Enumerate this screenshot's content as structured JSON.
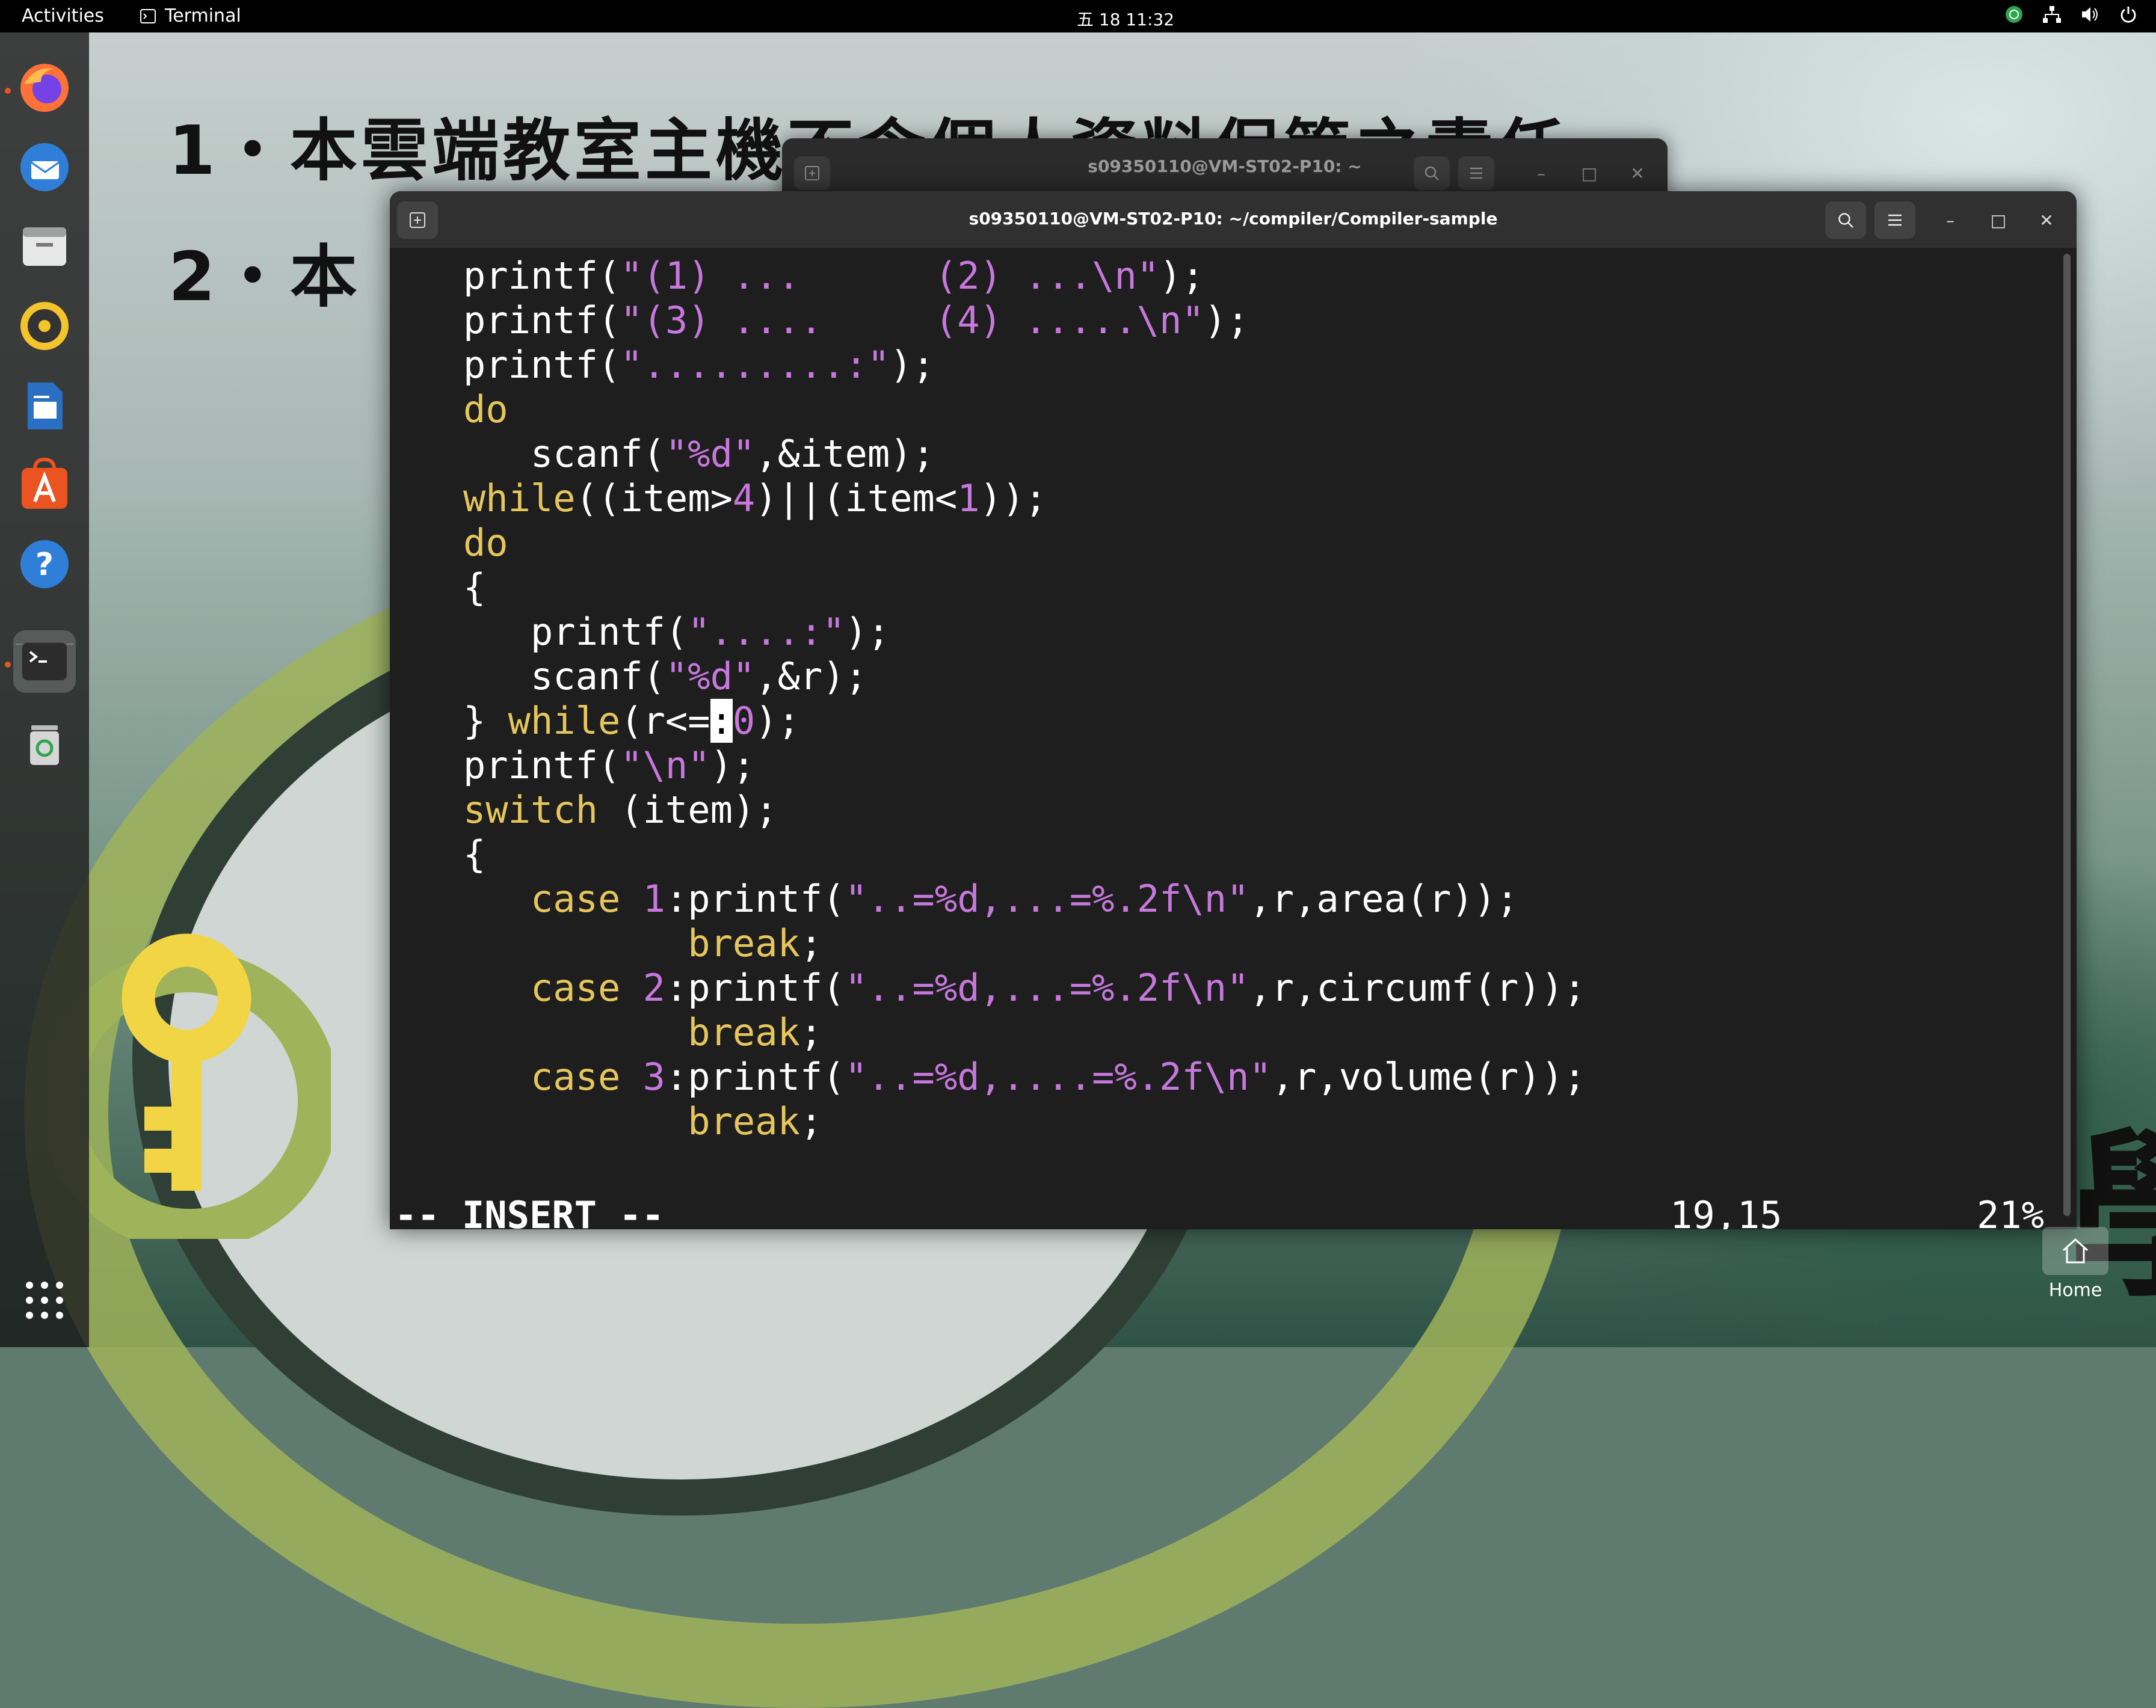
{
  "topbar": {
    "activities": "Activities",
    "app_name": "Terminal",
    "clock": "五 18 11:32"
  },
  "dock": {
    "items": [
      {
        "name": "firefox-icon"
      },
      {
        "name": "thunderbird-icon"
      },
      {
        "name": "files-icon"
      },
      {
        "name": "rhythmbox-icon"
      },
      {
        "name": "libreoffice-writer-icon"
      },
      {
        "name": "app-center-icon"
      },
      {
        "name": "help-icon"
      },
      {
        "name": "terminal-icon"
      },
      {
        "name": "trash-icon"
      },
      {
        "name": "show-apps-icon"
      }
    ]
  },
  "wallpaper": {
    "line1": "1・本雲端教室主機不含個人資料保管之責任",
    "line2": "2・本",
    "colors": {
      "ring": "#9fb35a",
      "key": "#f2d544"
    }
  },
  "back_window": {
    "title": "s09350110@VM-ST02-P10: ~"
  },
  "window": {
    "title": "s09350110@VM-ST02-P10: ~/compiler/Compiler-sample"
  },
  "editor": {
    "mode": "-- INSERT --",
    "position": "19,15",
    "percent": "21%",
    "colors": {
      "keyword": "#e6c65c",
      "string": "#c678dd",
      "text": "#ffffff",
      "background": "#1e1e1e"
    },
    "lines": [
      [
        {
          "t": "   printf(",
          "c": "n"
        },
        {
          "t": "\"(1) ...      (2) ...\\n\"",
          "c": "s"
        },
        {
          "t": ");",
          "c": "n"
        }
      ],
      [
        {
          "t": "   printf(",
          "c": "n"
        },
        {
          "t": "\"(3) ....     (4) .....\\n\"",
          "c": "s"
        },
        {
          "t": ");",
          "c": "n"
        }
      ],
      [
        {
          "t": "   printf(",
          "c": "n"
        },
        {
          "t": "\".........:\"",
          "c": "s"
        },
        {
          "t": ");",
          "c": "n"
        }
      ],
      [
        {
          "t": "   ",
          "c": "n"
        },
        {
          "t": "do",
          "c": "k"
        }
      ],
      [
        {
          "t": "      scanf(",
          "c": "n"
        },
        {
          "t": "\"%d\"",
          "c": "s"
        },
        {
          "t": ",&item);",
          "c": "n"
        }
      ],
      [
        {
          "t": "   ",
          "c": "n"
        },
        {
          "t": "while",
          "c": "k"
        },
        {
          "t": "((item>",
          "c": "n"
        },
        {
          "t": "4",
          "c": "d"
        },
        {
          "t": ")||(item<",
          "c": "n"
        },
        {
          "t": "1",
          "c": "d"
        },
        {
          "t": "));",
          "c": "n"
        }
      ],
      [
        {
          "t": "   ",
          "c": "n"
        },
        {
          "t": "do",
          "c": "k"
        }
      ],
      [
        {
          "t": "   {",
          "c": "n"
        }
      ],
      [
        {
          "t": "      printf(",
          "c": "n"
        },
        {
          "t": "\"....:\"",
          "c": "s"
        },
        {
          "t": ");",
          "c": "n"
        }
      ],
      [
        {
          "t": "      scanf(",
          "c": "n"
        },
        {
          "t": "\"%d\"",
          "c": "s"
        },
        {
          "t": ",&r);",
          "c": "n"
        }
      ],
      [
        {
          "t": "   } ",
          "c": "n"
        },
        {
          "t": "while",
          "c": "k"
        },
        {
          "t": "(r<=",
          "c": "n"
        },
        {
          "t": ":",
          "c": "cur"
        },
        {
          "t": "0",
          "c": "d"
        },
        {
          "t": ");",
          "c": "n"
        }
      ],
      [
        {
          "t": "   printf(",
          "c": "n"
        },
        {
          "t": "\"\\n\"",
          "c": "s"
        },
        {
          "t": ");",
          "c": "n"
        }
      ],
      [
        {
          "t": "   ",
          "c": "n"
        },
        {
          "t": "switch",
          "c": "k"
        },
        {
          "t": " (item);",
          "c": "n"
        }
      ],
      [
        {
          "t": "   {",
          "c": "n"
        }
      ],
      [
        {
          "t": "      ",
          "c": "n"
        },
        {
          "t": "case",
          "c": "k"
        },
        {
          "t": " ",
          "c": "n"
        },
        {
          "t": "1",
          "c": "d"
        },
        {
          "t": ":printf(",
          "c": "n"
        },
        {
          "t": "\"..=%d,...=%.2f\\n\"",
          "c": "s"
        },
        {
          "t": ",r,area(r));",
          "c": "n"
        }
      ],
      [
        {
          "t": "             ",
          "c": "n"
        },
        {
          "t": "break",
          "c": "k"
        },
        {
          "t": ";",
          "c": "n"
        }
      ],
      [
        {
          "t": "      ",
          "c": "n"
        },
        {
          "t": "case",
          "c": "k"
        },
        {
          "t": " ",
          "c": "n"
        },
        {
          "t": "2",
          "c": "d"
        },
        {
          "t": ":printf(",
          "c": "n"
        },
        {
          "t": "\"..=%d,...=%.2f\\n\"",
          "c": "s"
        },
        {
          "t": ",r,circumf(r));",
          "c": "n"
        }
      ],
      [
        {
          "t": "             ",
          "c": "n"
        },
        {
          "t": "break",
          "c": "k"
        },
        {
          "t": ";",
          "c": "n"
        }
      ],
      [
        {
          "t": "      ",
          "c": "n"
        },
        {
          "t": "case",
          "c": "k"
        },
        {
          "t": " ",
          "c": "n"
        },
        {
          "t": "3",
          "c": "d"
        },
        {
          "t": ":printf(",
          "c": "n"
        },
        {
          "t": "\"..=%d,....=%.2f\\n\"",
          "c": "s"
        },
        {
          "t": ",r,volume(r));",
          "c": "n"
        }
      ],
      [
        {
          "t": "             ",
          "c": "n"
        },
        {
          "t": "break",
          "c": "k"
        },
        {
          "t": ";",
          "c": "n"
        }
      ]
    ]
  },
  "desktop": {
    "home_label": "Home"
  }
}
